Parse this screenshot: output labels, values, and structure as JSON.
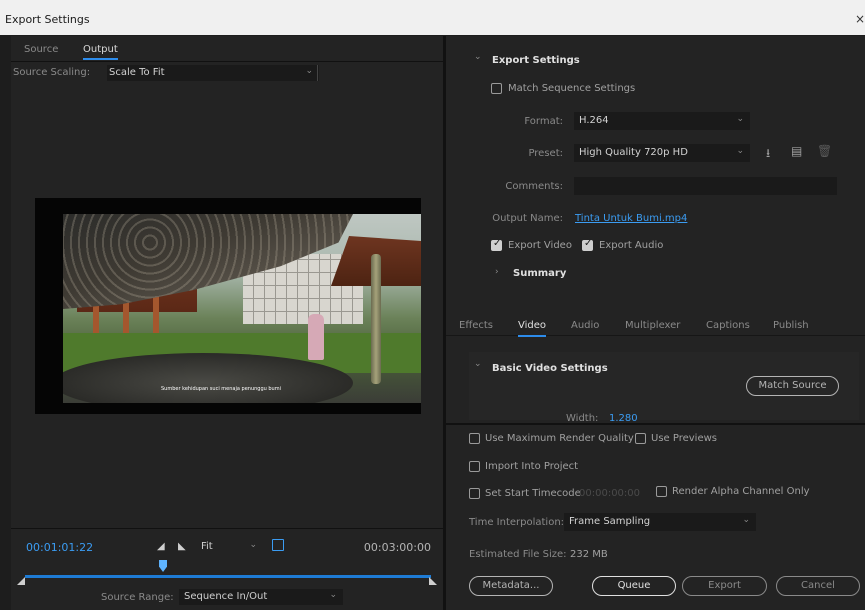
{
  "window": {
    "title": "Export Settings",
    "close_glyph": "×"
  },
  "left_tabs": [
    "Source",
    "Output"
  ],
  "source_scaling": {
    "label": "Source Scaling:",
    "value": "Scale To Fit"
  },
  "preview": {
    "subtitle": "Sumber kehidupan suci menaja penunggu bumi"
  },
  "timeline": {
    "current_timecode": "00:01:01:22",
    "end_timecode": "00:03:00:00",
    "zoom": "Fit",
    "playhead_fraction": 0.34
  },
  "source_range": {
    "label": "Source Range:",
    "value": "Sequence In/Out"
  },
  "export_settings": {
    "header": "Export Settings",
    "match_sequence_label": "Match Sequence Settings",
    "match_sequence_checked": false,
    "format_label": "Format:",
    "format_value": "H.264",
    "preset_label": "Preset:",
    "preset_value": "High Quality 720p HD",
    "comments_label": "Comments:",
    "comments_value": "",
    "output_name_label": "Output Name:",
    "output_name_value": "Tinta Untuk Bumi.mp4",
    "export_video_label": "Export Video",
    "export_video_checked": true,
    "export_audio_label": "Export Audio",
    "export_audio_checked": true,
    "summary_label": "Summary"
  },
  "tabs": [
    "Effects",
    "Video",
    "Audio",
    "Multiplexer",
    "Captions",
    "Publish"
  ],
  "active_tab": "Video",
  "video_settings": {
    "header": "Basic Video Settings",
    "match_source_label": "Match Source",
    "width_label": "Width:",
    "width_value": "1.280"
  },
  "bottom_options": {
    "max_render_quality": "Use Maximum Render Quality",
    "use_previews": "Use Previews",
    "import_into_project": "Import Into Project",
    "set_start_timecode": "Set Start Timecode",
    "start_timecode_value": "00:00:00:00",
    "render_alpha_only": "Render Alpha Channel Only",
    "time_interpolation_label": "Time Interpolation:",
    "time_interpolation_value": "Frame Sampling",
    "estimated_size_label": "Estimated File Size:",
    "estimated_size_value": "232 MB"
  },
  "buttons": {
    "metadata": "Metadata...",
    "queue": "Queue",
    "export": "Export",
    "cancel": "Cancel"
  },
  "colors": {
    "accent": "#2d8ceb",
    "link": "#3b9cf2",
    "panel": "#232323",
    "background": "#1d1d1d"
  }
}
